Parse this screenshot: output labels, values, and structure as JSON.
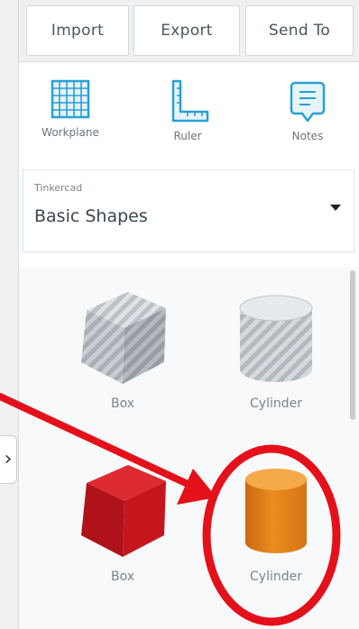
{
  "toolbar": {
    "import_label": "Import",
    "export_label": "Export",
    "sendto_label": "Send To"
  },
  "tools": [
    {
      "label": "Workplane",
      "icon": "workplane-icon"
    },
    {
      "label": "Ruler",
      "icon": "ruler-icon"
    },
    {
      "label": "Notes",
      "icon": "notes-icon"
    }
  ],
  "library_selector": {
    "provider": "Tinkercad",
    "selected": "Basic Shapes"
  },
  "shapes": [
    {
      "label": "Box",
      "style": "hole",
      "color": "#b9bfc4"
    },
    {
      "label": "Cylinder",
      "style": "hole",
      "color": "#c4c9cd"
    },
    {
      "label": "Box",
      "style": "solid",
      "color": "#c0141c"
    },
    {
      "label": "Cylinder",
      "style": "solid",
      "color": "#e8861a"
    }
  ],
  "annotation": {
    "color": "#e4101a"
  },
  "colors": {
    "tool_icon": "#2a9fd6",
    "panel_bg": "#ffffff"
  }
}
